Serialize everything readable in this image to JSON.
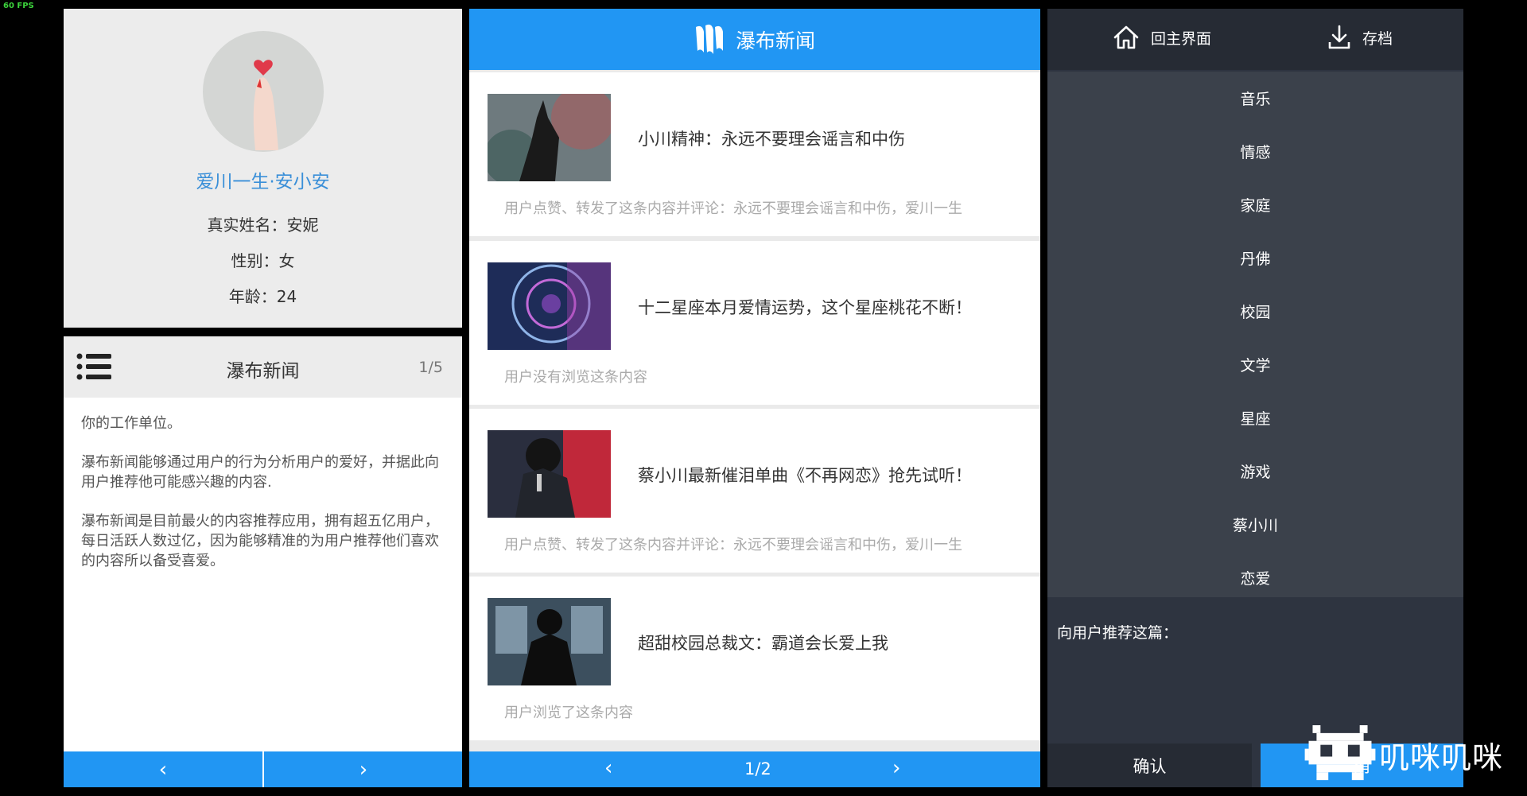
{
  "fps": "60 FPS",
  "profile": {
    "name": "爱川一生·安小安",
    "real_name": "真实姓名：安妮",
    "gender": "性别：女",
    "age": "年龄：24"
  },
  "info": {
    "title": "瀑布新闻",
    "page": "1/5",
    "paragraphs": [
      "你的工作单位。",
      "瀑布新闻能够通过用户的行为分析用户的爱好，并据此向用户推荐他可能感兴趣的内容.",
      "瀑布新闻是目前最火的内容推荐应用，拥有超五亿用户，每日活跃人数过亿，因为能够精准的为用户推荐他们喜欢的内容所以备受喜爱。"
    ],
    "prev": "‹",
    "next": "›"
  },
  "feed": {
    "title": "瀑布新闻",
    "items": [
      {
        "title": "小川精神：永远不要理会谣言和中伤",
        "desc": "用户点赞、转发了这条内容并评论：永远不要理会谣言和中伤，爱川一生"
      },
      {
        "title": "十二星座本月爱情运势，这个星座桃花不断！",
        "desc": "用户没有浏览这条内容"
      },
      {
        "title": "蔡小川最新催泪单曲《不再网恋》抢先试听！",
        "desc": "用户点赞、转发了这条内容并评论：永远不要理会谣言和中伤，爱川一生"
      },
      {
        "title": "超甜校园总裁文：霸道会长爱上我",
        "desc": "用户浏览了这条内容"
      }
    ],
    "page": "1/2",
    "prev": "‹",
    "next": "›"
  },
  "right": {
    "home_label": "回主界面",
    "save_label": "存档",
    "categories": [
      "音乐",
      "情感",
      "家庭",
      "丹佛",
      "校园",
      "文学",
      "星座",
      "游戏",
      "蔡小川",
      "恋爱"
    ],
    "recommend_label": "向用户推荐这篇：",
    "confirm_label": "确认",
    "cancel_label": "消"
  },
  "watermark": "叽咪叽咪",
  "colors": {
    "accent": "#2196f3",
    "dark_panel": "#2e3440",
    "category_bg": "#3b414b"
  }
}
